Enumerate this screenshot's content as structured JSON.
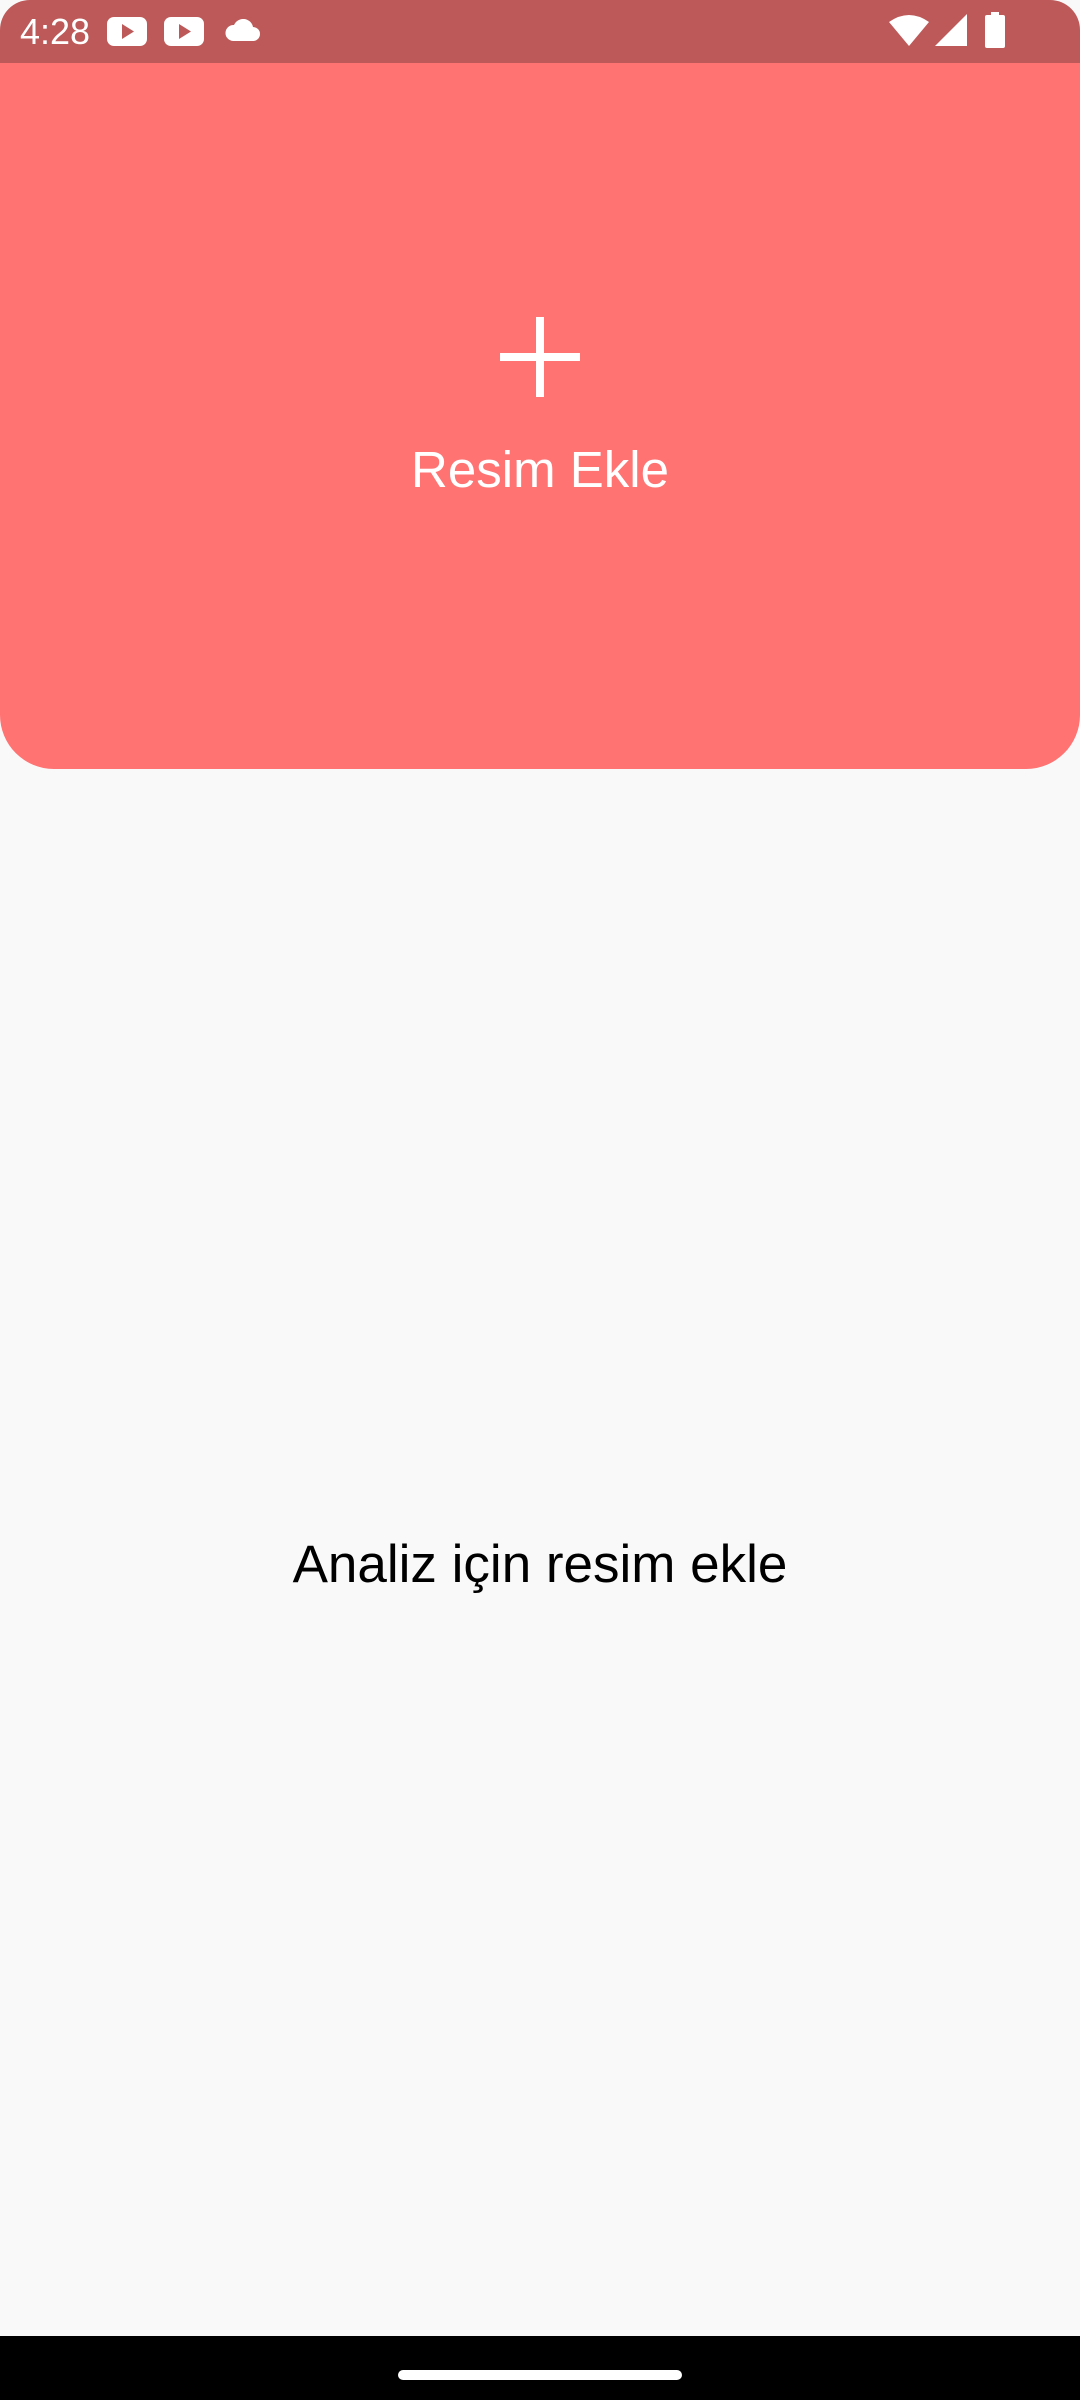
{
  "status_bar": {
    "time": "4:28",
    "left_icons": [
      "youtube-icon",
      "youtube-icon",
      "cloud-icon"
    ],
    "right_icons": [
      "wifi-icon",
      "cellular-signal-icon",
      "battery-icon"
    ]
  },
  "header": {
    "icon": "plus-icon",
    "add_image_label": "Resim Ekle"
  },
  "main": {
    "empty_state_text": "Analiz için resim ekle"
  },
  "nav_bar": {
    "handle": "home-indicator"
  },
  "colors": {
    "status_bar_bg": "#bd5959",
    "header_bg": "#ff7373",
    "page_bg": "#f9f9f9",
    "nav_bar_bg": "#000000",
    "text_on_accent": "#ffffff",
    "body_text": "#000000"
  }
}
